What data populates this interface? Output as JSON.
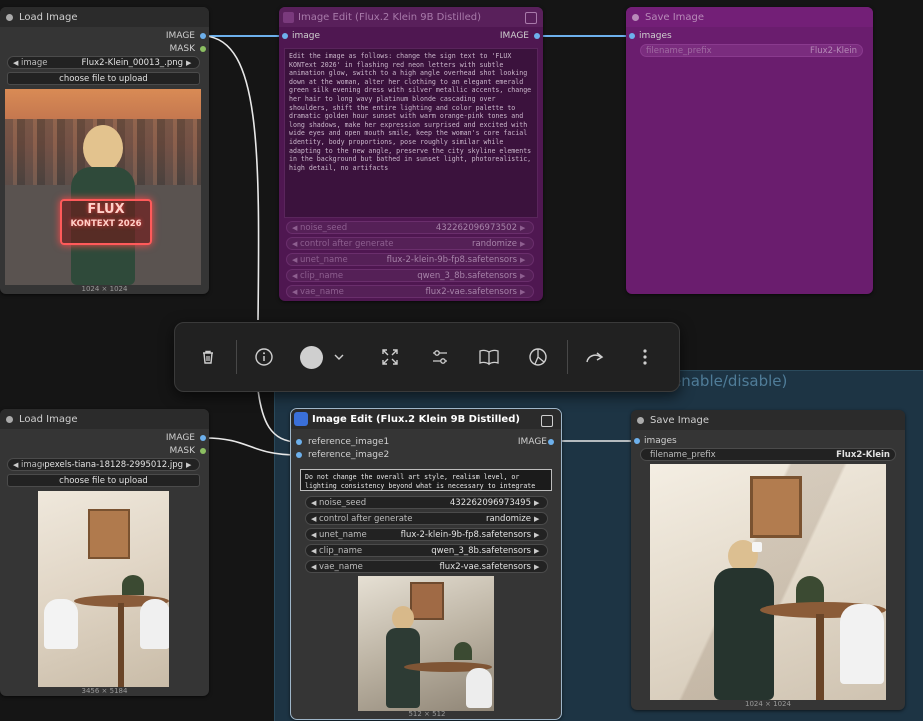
{
  "group": {
    "title": "enable/disable)"
  },
  "node_load1": {
    "title": "Load Image",
    "outputs": [
      "IMAGE",
      "MASK"
    ],
    "image_widget": {
      "name": "image",
      "value": "Flux2-Klein_00013_.png"
    },
    "upload_label": "choose file to upload",
    "preview_text_top": "FLUX",
    "preview_text_bottom": "KONTEXT 2026",
    "dims": "1024 × 1024"
  },
  "node_edit1": {
    "title": "Image Edit (Flux.2 Klein 9B Distilled)",
    "input": "image",
    "output": "IMAGE",
    "prompt": "Edit the image as follows: change the sign text to 'FLUX KONText 2026' in flashing red neon letters with subtle animation glow, switch to a high angle overhead shot looking down at the woman, alter her clothing to an elegant emerald green silk evening dress with silver metallic accents, change her hair to long wavy platinum blonde cascading over shoulders, shift the entire lighting and color palette to dramatic golden hour sunset with warm orange-pink tones and long shadows, make her expression surprised and excited with wide eyes and open mouth smile, keep the woman's core facial identity, body proportions, pose roughly similar while adapting to the new angle, preserve the city skyline elements in the background but bathed in sunset light, photorealistic, high detail, no artifacts",
    "widgets": [
      {
        "name": "noise_seed",
        "value": "432262096973502"
      },
      {
        "name": "control after generate",
        "value": "randomize"
      },
      {
        "name": "unet_name",
        "value": "flux-2-klein-9b-fp8.safetensors"
      },
      {
        "name": "clip_name",
        "value": "qwen_3_8b.safetensors"
      },
      {
        "name": "vae_name",
        "value": "flux2-vae.safetensors"
      }
    ]
  },
  "node_save1": {
    "title": "Save Image",
    "input": "images",
    "widget": {
      "name": "filename_prefix",
      "value": "Flux2-Klein"
    }
  },
  "toolbar": {
    "buttons": [
      "delete-icon",
      "info-icon",
      "color-icon",
      "fit-icon",
      "settings-icon",
      "book-icon",
      "bypass-icon",
      "redo-icon",
      "more-icon"
    ],
    "color_value": "#cfcfcf"
  },
  "node_load2": {
    "title": "Load Image",
    "outputs": [
      "IMAGE",
      "MASK"
    ],
    "image_widget": {
      "name": "image",
      "value": "pexels-tiana-18128-2995012.jpg"
    },
    "upload_label": "choose file to upload",
    "dims": "3456 × 5184"
  },
  "node_edit2": {
    "title": "Image Edit (Flux.2 Klein 9B Distilled)",
    "inputs": [
      "reference_image1",
      "reference_image2"
    ],
    "output": "IMAGE",
    "prompt": "Do not change the overall art style, realism level, or lighting consistency beyond what is necessary to integrate the subject naturally.",
    "widgets": [
      {
        "name": "noise_seed",
        "value": "432262096973495"
      },
      {
        "name": "control after generate",
        "value": "randomize"
      },
      {
        "name": "unet_name",
        "value": "flux-2-klein-9b-fp8.safetensors"
      },
      {
        "name": "clip_name",
        "value": "qwen_3_8b.safetensors"
      },
      {
        "name": "vae_name",
        "value": "flux2-vae.safetensors"
      }
    ],
    "dims": "512 × 512"
  },
  "node_save2": {
    "title": "Save Image",
    "input": "images",
    "widget": {
      "name": "filename_prefix",
      "value": "Flux2-Klein"
    },
    "dims": "1024 × 1024"
  }
}
